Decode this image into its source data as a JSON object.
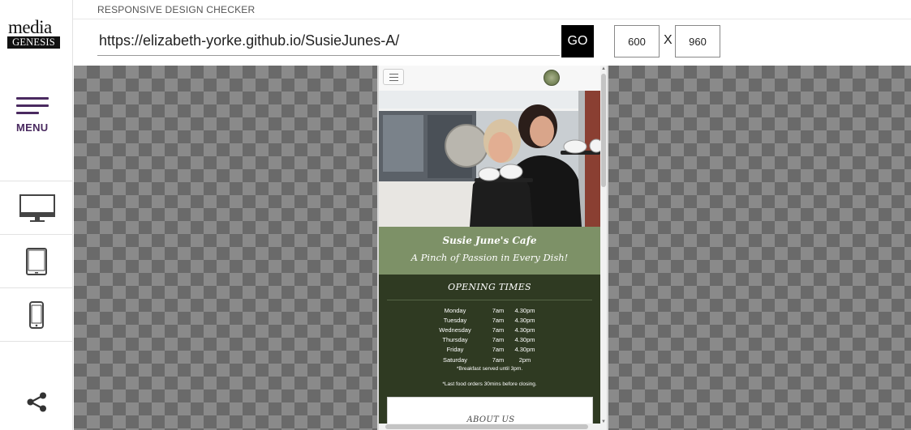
{
  "app": {
    "header_label": "RESPONSIVE DESIGN CHECKER",
    "logo": {
      "top": "media",
      "bottom": "GENESIS"
    },
    "menu_label": "MENU",
    "devices": [
      {
        "name": "desktop",
        "icon": "desktop-icon"
      },
      {
        "name": "tablet",
        "icon": "tablet-icon"
      },
      {
        "name": "mobile",
        "icon": "mobile-icon"
      }
    ],
    "share_icon": "share-icon",
    "accent_color": "#4a2a60"
  },
  "toolbar": {
    "url": "https://elizabeth-yorke.github.io/SusieJunes-A/",
    "go_label": "GO",
    "width": "600",
    "height": "960",
    "x_label": "X"
  },
  "site": {
    "title": "Susie June's Cafe",
    "tagline": "A Pinch of Passion in Every Dish!",
    "opening_title": "OPENING TIMES",
    "hours": [
      {
        "day": "Monday",
        "open": "7am",
        "close": "4.30pm"
      },
      {
        "day": "Tuesday",
        "open": "7am",
        "close": "4.30pm"
      },
      {
        "day": "Wednesday",
        "open": "7am",
        "close": "4.30pm"
      },
      {
        "day": "Thursday",
        "open": "7am",
        "close": "4.30pm"
      },
      {
        "day": "Friday",
        "open": "7am",
        "close": "4.30pm"
      },
      {
        "day": "Saturday",
        "open": "7am",
        "close": "2pm"
      }
    ],
    "notes": [
      "*Breakfast served until 3pm.",
      "*Last food orders 30mins before closing."
    ],
    "about_title": "ABOUT US",
    "colors": {
      "green": "#7d9167",
      "dark_green": "#2f3a22"
    }
  }
}
